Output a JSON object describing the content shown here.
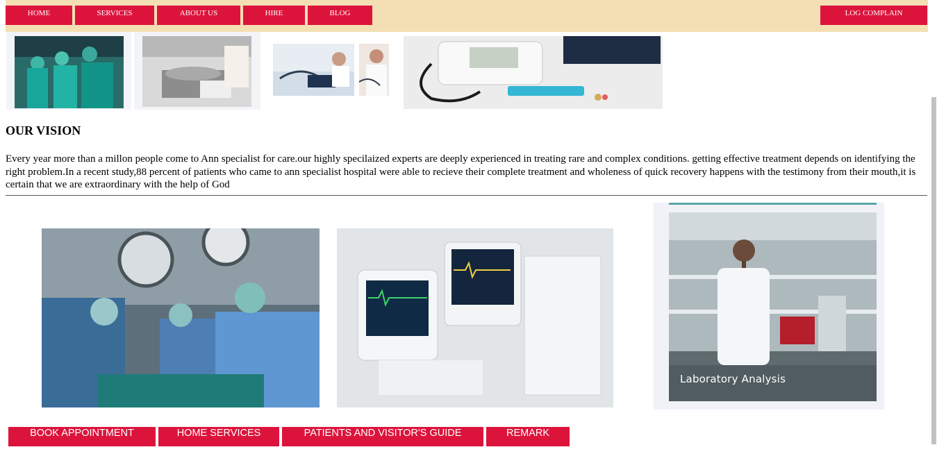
{
  "nav": {
    "home": "HOME",
    "services": "SERVICES",
    "about": "ABOUT US",
    "hire": "HIRE",
    "blog": "BLOG",
    "log_complain": "LOG COMPLAIN"
  },
  "vision": {
    "title": "OUR VISION",
    "text": "Every year more than a millon people come to Ann specialist for care.our highly specilaized experts are deeply experienced in treating rare and complex conditions. getting effective treatment depends on identifying the right problem.In a recent study,88 percent of patients who came to ann specialist hospital were able to recieve their complete treatment and wholeness of quick recovery happens with the testimony from their mouth,it is certain that we are extraordinary with the help of God"
  },
  "lab": {
    "caption": "Laboratory  Analysis"
  },
  "actions": {
    "book": "BOOK APPOINTMENT",
    "home_services": "HOME SERVICES",
    "guide": "PATIENTS AND VISITOR'S GUIDE",
    "remark": "REMARK"
  },
  "colors": {
    "nav_bg": "#f4dfb4",
    "button": "#dc143c"
  }
}
